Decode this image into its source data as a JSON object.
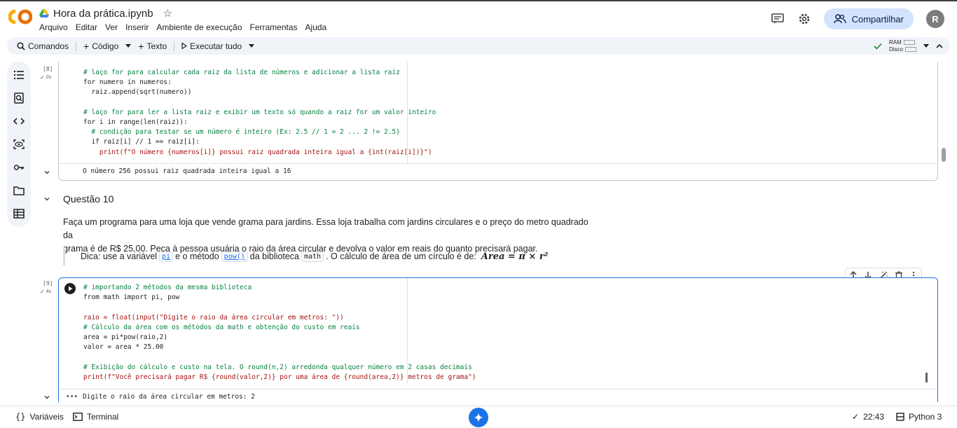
{
  "header": {
    "title": "Hora da prática.ipynb",
    "menu": [
      "Arquivo",
      "Editar",
      "Ver",
      "Inserir",
      "Ambiente de execução",
      "Ferramentas",
      "Ajuda"
    ],
    "share_label": "Compartilhar",
    "avatar_initial": "R"
  },
  "toolbar": {
    "commands": "Comandos",
    "code": "Código",
    "text": "Texto",
    "run_all": "Executar tudo",
    "ram": "RAM",
    "disk": "Disco"
  },
  "cell8": {
    "exec": "[8]",
    "time": "0s",
    "lines": [
      "# laço for para calcular cada raiz da lista de números e adicionar a lista raiz",
      "for numero in numeros:",
      "  raiz.append(sqrt(numero))",
      "",
      "# laço for para ler a lista raiz e exibir um texto só quando a raiz for um valor inteiro",
      "for i in range(len(raiz)):",
      "  # condição para testar se um número é inteiro (Ex: 2.5 // 1 = 2 ... 2 != 2.5)",
      "  if raiz[i] // 1 == raiz[i]:",
      "    print(f\"O número {numeros[i]} possui raiz quadrada inteira igual a {int(raiz[i])}\")"
    ],
    "output": "O número 256 possui raiz quadrada inteira igual a 16"
  },
  "q10": {
    "title": "Questão 10",
    "paragraph_1": "Faça um programa para uma loja que vende grama para jardins. Essa loja trabalha com jardins circulares e o preço do metro quadrado da",
    "paragraph_2": "grama é de R$ 25,00. Peça à pessoa usuária o raio da área circular e devolva o valor em reais do quanto precisará pagar.",
    "tip_1": "Dica: use a variável",
    "tip_pi": "pi",
    "tip_2": "e o método",
    "tip_pow": "pow()",
    "tip_3": "da biblioteca",
    "tip_math": "math",
    "tip_4": ". O cálculo de área de um círculo é de:",
    "formula": "Area = π × r²"
  },
  "cell9": {
    "exec": "[9]",
    "time": "4s",
    "lines": [
      "# importando 2 métodos da mesma biblioteca",
      "from math import pi, pow",
      "",
      "raio = float(input(\"Digite o raio da área circular em metros: \"))",
      "# Cálculo da área com os métodos da math e obtenção do custo em reais",
      "area = pi*pow(raio,2)",
      "valor = area * 25.00",
      "",
      "# Exibição do cálculo e custo na tela. O round(n,2) arredonda qualquer número em 2 casas decimais",
      "print(f\"Você precisará pagar R$ {round(valor,2)} por uma área de {round(area,2)} metros de grama\")"
    ],
    "output": "Digite o raio da área circular em metros: 2"
  },
  "footer": {
    "variables": "Variáveis",
    "terminal": "Terminal",
    "time": "22:43",
    "runtime": "Python 3"
  }
}
